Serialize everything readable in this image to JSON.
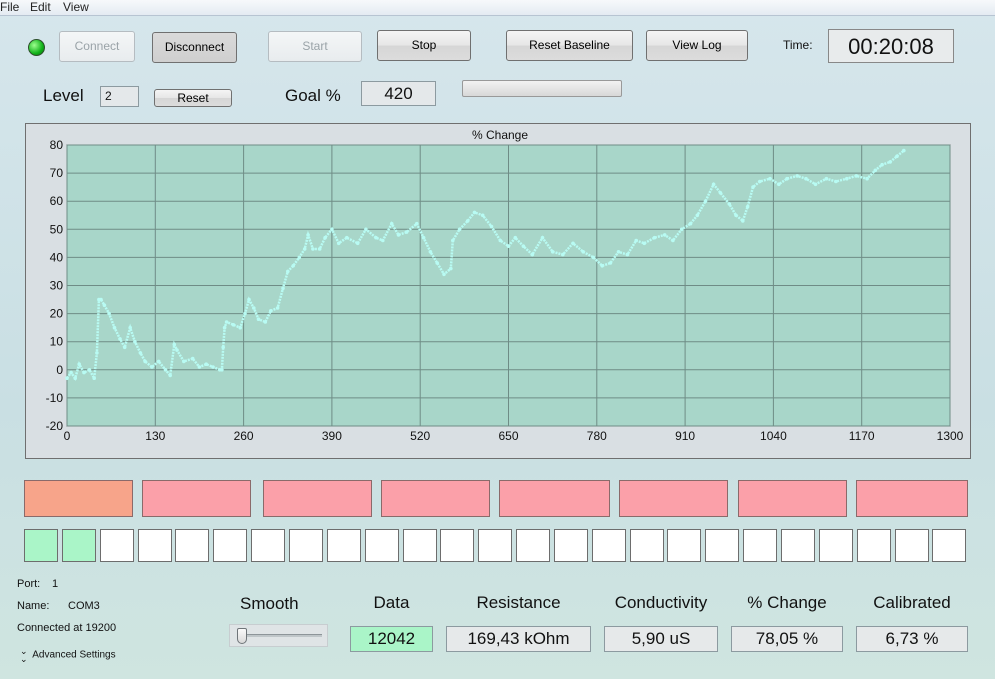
{
  "menu": {
    "file": "File",
    "edit": "Edit",
    "view": "View"
  },
  "toolbar": {
    "connect": "Connect",
    "disconnect": "Disconnect",
    "start": "Start",
    "stop": "Stop",
    "reset_baseline": "Reset Baseline",
    "view_log": "View Log",
    "time_label": "Time:",
    "time_value": "00:20:08",
    "connection_led_color": "#11b21a"
  },
  "level": {
    "label": "Level",
    "value": "2",
    "reset": "Reset"
  },
  "goal": {
    "label": "Goal %",
    "value": "420",
    "progress_fraction": 0
  },
  "chart_data": {
    "type": "scatter",
    "title": "% Change",
    "xlabel": "",
    "ylabel": "",
    "xlim": [
      0,
      1300
    ],
    "ylim": [
      -20,
      80
    ],
    "x_ticks": [
      "0",
      "130",
      "260",
      "390",
      "520",
      "650",
      "780",
      "910",
      "1040",
      "1170",
      "1300"
    ],
    "y_ticks": [
      "80",
      "70",
      "60",
      "50",
      "40",
      "30",
      "20",
      "10",
      "0",
      "-10",
      "-20"
    ],
    "grid": true,
    "series": [
      {
        "color": "#b8fbf3",
        "points": [
          [
            0,
            -3
          ],
          [
            6,
            -1
          ],
          [
            12,
            -3
          ],
          [
            18,
            2
          ],
          [
            25,
            -1
          ],
          [
            33,
            0
          ],
          [
            40,
            -3
          ],
          [
            44,
            6
          ],
          [
            47,
            25
          ],
          [
            50,
            25
          ],
          [
            55,
            23
          ],
          [
            62,
            20
          ],
          [
            70,
            15
          ],
          [
            78,
            11
          ],
          [
            85,
            8
          ],
          [
            93,
            15
          ],
          [
            100,
            10
          ],
          [
            108,
            6
          ],
          [
            115,
            3
          ],
          [
            125,
            1
          ],
          [
            135,
            3
          ],
          [
            145,
            0
          ],
          [
            152,
            -2
          ],
          [
            158,
            9
          ],
          [
            162,
            7
          ],
          [
            172,
            3
          ],
          [
            185,
            4
          ],
          [
            195,
            1
          ],
          [
            205,
            2
          ],
          [
            215,
            1
          ],
          [
            225,
            0
          ],
          [
            228,
            0
          ],
          [
            230,
            8
          ],
          [
            232,
            15
          ],
          [
            235,
            17
          ],
          [
            245,
            16
          ],
          [
            255,
            15
          ],
          [
            262,
            20
          ],
          [
            268,
            25
          ],
          [
            275,
            22
          ],
          [
            282,
            18
          ],
          [
            292,
            17
          ],
          [
            300,
            21
          ],
          [
            310,
            22
          ],
          [
            318,
            29
          ],
          [
            325,
            35
          ],
          [
            333,
            37
          ],
          [
            342,
            40
          ],
          [
            350,
            43
          ],
          [
            355,
            48
          ],
          [
            362,
            43
          ],
          [
            372,
            43
          ],
          [
            380,
            47
          ],
          [
            390,
            50
          ],
          [
            400,
            45
          ],
          [
            412,
            47
          ],
          [
            428,
            45
          ],
          [
            440,
            50
          ],
          [
            455,
            47
          ],
          [
            465,
            46
          ],
          [
            478,
            52
          ],
          [
            488,
            48
          ],
          [
            500,
            49
          ],
          [
            515,
            52
          ],
          [
            525,
            47
          ],
          [
            535,
            42
          ],
          [
            545,
            38
          ],
          [
            555,
            34
          ],
          [
            565,
            36
          ],
          [
            568,
            46
          ],
          [
            578,
            50
          ],
          [
            590,
            53
          ],
          [
            600,
            56
          ],
          [
            612,
            55
          ],
          [
            625,
            51
          ],
          [
            638,
            46
          ],
          [
            650,
            44
          ],
          [
            660,
            47
          ],
          [
            672,
            44
          ],
          [
            685,
            41
          ],
          [
            700,
            47
          ],
          [
            715,
            42
          ],
          [
            730,
            41
          ],
          [
            745,
            45
          ],
          [
            760,
            42
          ],
          [
            775,
            40
          ],
          [
            788,
            37
          ],
          [
            800,
            38
          ],
          [
            812,
            42
          ],
          [
            825,
            41
          ],
          [
            838,
            46
          ],
          [
            850,
            45
          ],
          [
            865,
            47
          ],
          [
            880,
            48
          ],
          [
            892,
            46
          ],
          [
            905,
            50
          ],
          [
            918,
            52
          ],
          [
            928,
            55
          ],
          [
            940,
            60
          ],
          [
            952,
            66
          ],
          [
            962,
            63
          ],
          [
            975,
            59
          ],
          [
            985,
            55
          ],
          [
            995,
            53
          ],
          [
            1002,
            58
          ],
          [
            1010,
            65
          ],
          [
            1020,
            67
          ],
          [
            1035,
            68
          ],
          [
            1048,
            66
          ],
          [
            1060,
            68
          ],
          [
            1075,
            69
          ],
          [
            1088,
            68
          ],
          [
            1102,
            66
          ],
          [
            1118,
            68
          ],
          [
            1132,
            67
          ],
          [
            1148,
            68
          ],
          [
            1162,
            69
          ],
          [
            1178,
            68
          ],
          [
            1190,
            71
          ],
          [
            1200,
            73
          ],
          [
            1212,
            74
          ],
          [
            1222,
            76
          ],
          [
            1232,
            78
          ]
        ]
      }
    ]
  },
  "level_blocks": [
    {
      "color": "#f7a48a"
    },
    {
      "color": "#fba0a9"
    },
    {
      "color": "#fba0a9"
    },
    {
      "color": "#fba0a9"
    },
    {
      "color": "#fba0a9"
    },
    {
      "color": "#fba0a9"
    },
    {
      "color": "#fba0a9"
    },
    {
      "color": "#fba0a9"
    }
  ],
  "progress_cells": {
    "total": 25,
    "filled": 2,
    "filled_color": "#aaf5c8",
    "empty_color": "#ffffff"
  },
  "device": {
    "port_label": "Port:",
    "port_value": "1",
    "name_label": "Name:",
    "name_value": "COM3",
    "status": "Connected at 19200",
    "advanced": "Advanced Settings"
  },
  "smooth": {
    "label": "Smooth",
    "level": 0
  },
  "readouts": {
    "data": {
      "label": "Data",
      "value": "12042",
      "highlight_color": "#aaf5c8"
    },
    "resistance": {
      "label": "Resistance",
      "value": "169,43 kOhm"
    },
    "conductivity": {
      "label": "Conductivity",
      "value": "5,90 uS"
    },
    "pct_change": {
      "label": "% Change",
      "value": "78,05 %"
    },
    "calibrated": {
      "label": "Calibrated",
      "value": "6,73 %"
    }
  }
}
